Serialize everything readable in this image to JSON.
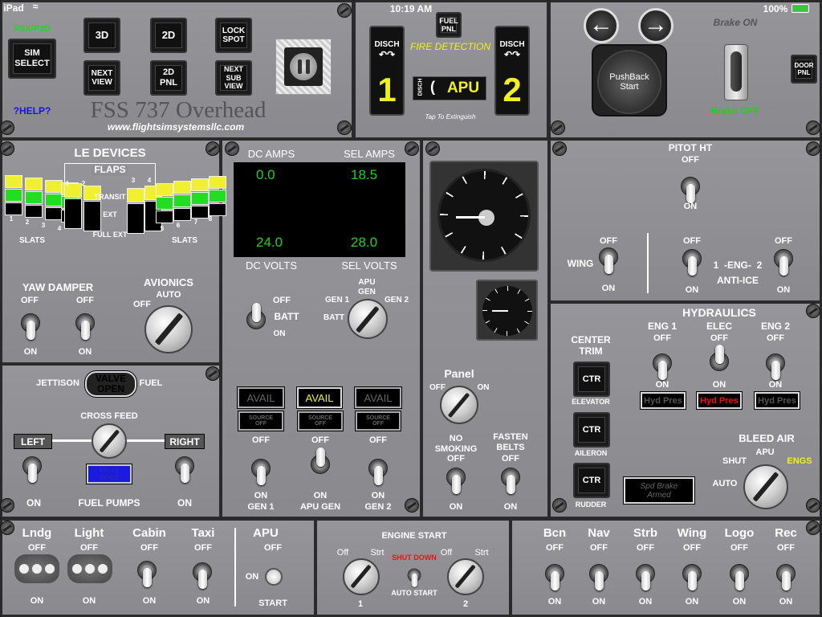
{
  "status": {
    "device": "iPad",
    "time": "10:19 AM",
    "battery": "100%"
  },
  "views": {
    "sim_label": "FSX/P3D",
    "sim_select": "SIM\nSELECT",
    "b3d": "3D",
    "b2d": "2D",
    "lock": "LOCK\nSPOT",
    "next": "NEXT\nVIEW",
    "pnl2d": "2D\nPNL",
    "nextsub": "NEXT\nSUB\nVIEW",
    "help": "?HELP?",
    "title": "FSS 737 Overhead",
    "url": "www.flightsimsystemsllc.com",
    "pause_icon": "pause-icon"
  },
  "fire": {
    "fuel_pnl": "FUEL\nPNL",
    "disch": "DISCH",
    "one": "1",
    "two": "2",
    "title": "FIRE\nDETECTION",
    "apu": "APU",
    "tap": "Tap To\nExtinguish"
  },
  "pushback": {
    "brake_on": "Brake ON",
    "brake_off": "Brake OFF",
    "start": "PushBack\nStart",
    "door": "DOOR\nPNL"
  },
  "le": {
    "title": "LE DEVICES",
    "flaps": "FLAPS",
    "transit": "TRANSIT",
    "ext": "EXT",
    "full_ext": "FULL EXT",
    "slats": "SLATS",
    "nums": [
      "1",
      "2",
      "3",
      "4",
      "5",
      "6",
      "7",
      "8"
    ],
    "colors": {
      "transit": "#f0f030",
      "ext": "#22dd22"
    }
  },
  "yaw": {
    "title": "YAW DAMPER",
    "off": "OFF",
    "on": "ON"
  },
  "avionics": {
    "title": "AVIONICS",
    "auto": "AUTO",
    "off": "OFF"
  },
  "elec": {
    "dc_amps": "DC AMPS",
    "sel_amps": "SEL AMPS",
    "dc_volts": "DC VOLTS",
    "sel_volts": "SEL VOLTS",
    "dc_amps_val": "0.0",
    "sel_amps_val": "18.5",
    "dc_volts_val": "24.0",
    "sel_volts_val": "28.0",
    "off": "OFF",
    "batt": "BATT",
    "on": "ON",
    "apu_gen": "APU\nGEN",
    "gen1": "GEN 1",
    "gen2": "GEN 2",
    "avail": "AVAIL",
    "source_off": "SOURCE\nOFF",
    "apugen": "APU GEN"
  },
  "clock": {
    "panel": "Panel",
    "off": "OFF",
    "on": "ON",
    "no_smoking": "NO\nSMOKING",
    "fasten": "FASTEN\nBELTS"
  },
  "anti": {
    "pitot": "PITOT HT",
    "off": "OFF",
    "on": "ON",
    "wing": "WING",
    "eng": "1  -ENG-  2",
    "anti": "ANTI-ICE"
  },
  "hyd": {
    "title": "HYDRAULICS",
    "center_trim": "CENTER\nTRIM",
    "ctr": "CTR",
    "elevator": "ELEVATOR",
    "aileron": "AILERON",
    "rudder": "RUDDER",
    "eng1": "ENG 1",
    "elec": "ELEC",
    "eng2": "ENG 2",
    "off": "OFF",
    "on": "ON",
    "hyd_pres": "Hyd Pres",
    "spd": "Spd Brake\nArmed",
    "bleed": "BLEED AIR",
    "apu": "APU",
    "shut": "SHUT",
    "engs": "ENGS",
    "auto": "AUTO"
  },
  "fuel": {
    "jettison": "JETTISON",
    "valve": "VALVE\nOPEN",
    "fuel": "FUEL",
    "cross": "CROSS FEED",
    "left": "LEFT",
    "right": "RIGHT",
    "valve_open": "VALVE\nOPEN",
    "on": "ON",
    "pumps": "FUEL PUMPS"
  },
  "lights": {
    "lndg": "Lndg",
    "light": "Light",
    "cabin": "Cabin",
    "taxi": "Taxi",
    "apu": "APU",
    "off": "OFF",
    "on": "ON",
    "start": "START",
    "bcn": "Bcn",
    "nav": "Nav",
    "strb": "Strb",
    "wing": "Wing",
    "logo": "Logo",
    "rec": "Rec"
  },
  "engine": {
    "title": "ENGINE START",
    "off": "Off",
    "strt": "Strt",
    "shut": "SHUT DOWN",
    "auto": "AUTO START",
    "one": "1",
    "two": "2"
  }
}
